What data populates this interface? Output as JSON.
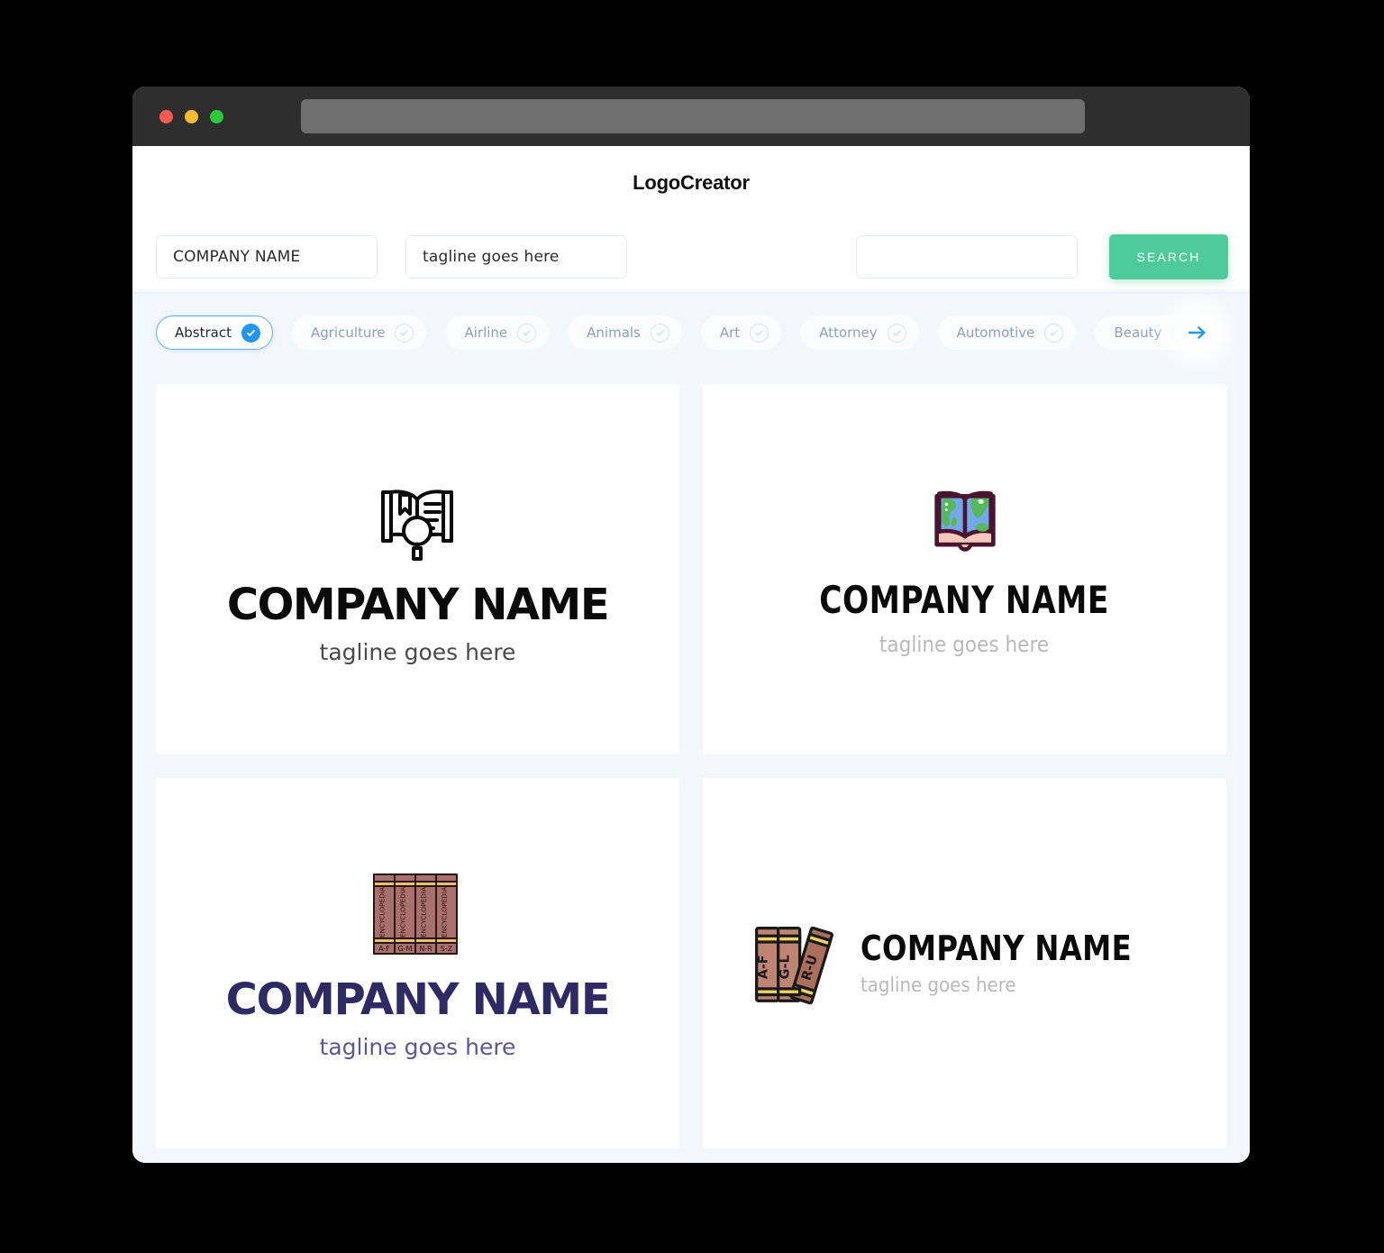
{
  "window": {
    "traffic_lights": [
      "close",
      "minimize",
      "maximize"
    ],
    "url_value": ""
  },
  "header": {
    "title": "LogoCreator"
  },
  "toolbar": {
    "company_value": "COMPANY NAME",
    "company_placeholder": "COMPANY NAME",
    "tagline_value": "tagline goes here",
    "tagline_placeholder": "tagline goes here",
    "third_value": "",
    "third_placeholder": "",
    "search_label": "SEARCH",
    "search_color": "#4ecb9b"
  },
  "filters": {
    "accent_color": "#2196f3",
    "next_label": "→",
    "chips": [
      {
        "label": "Abstract",
        "selected": true
      },
      {
        "label": "Agriculture",
        "selected": false
      },
      {
        "label": "Airline",
        "selected": false
      },
      {
        "label": "Animals",
        "selected": false
      },
      {
        "label": "Art",
        "selected": false
      },
      {
        "label": "Attorney",
        "selected": false
      },
      {
        "label": "Automotive",
        "selected": false
      },
      {
        "label": "Beauty",
        "selected": false
      }
    ]
  },
  "results": {
    "logos": [
      {
        "icon": "open-book-magnifier-icon",
        "name": "COMPANY NAME",
        "tagline": "tagline goes here",
        "name_color": "#0a0a0a",
        "tagline_color": "#4a4a4a",
        "layout": "stacked"
      },
      {
        "icon": "book-world-map-icon",
        "name": "COMPANY NAME",
        "tagline": "tagline goes here",
        "name_color": "#0a0a0a",
        "tagline_color": "#b9b9b9",
        "layout": "stacked"
      },
      {
        "icon": "encyclopedia-volumes-icon",
        "name": "COMPANY NAME",
        "tagline": "tagline goes here",
        "name_color": "#2e2a63",
        "tagline_color": "#5b5991",
        "layout": "stacked",
        "volumes": [
          "A-F",
          "G-M",
          "N-R",
          "S-Z"
        ],
        "spine_text": "ENCYCLOPEDIA"
      },
      {
        "icon": "three-books-icon",
        "name": "COMPANY NAME",
        "tagline": "tagline goes here",
        "name_color": "#0a0a0a",
        "tagline_color": "#b9b9b9",
        "layout": "horizontal",
        "volumes": [
          "A-F",
          "G-L",
          "R-U"
        ]
      }
    ]
  }
}
